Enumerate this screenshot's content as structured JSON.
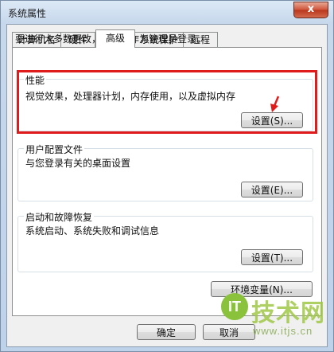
{
  "window": {
    "title": "系统属性",
    "close_glyph": "x"
  },
  "tabs": [
    {
      "label": "计算机名"
    },
    {
      "label": "硬件"
    },
    {
      "label": "高级"
    },
    {
      "label": "系统保护"
    },
    {
      "label": "远程"
    }
  ],
  "active_tab": "高级",
  "admin_note": "要进行大多数更改，您必须作为管理员登录。",
  "performance": {
    "title": "性能",
    "description": "视觉效果，处理器计划，内存使用，以及虚拟内存",
    "button_label": "设置(S)..."
  },
  "user_profiles": {
    "title": "用户配置文件",
    "description": "与您登录有关的桌面设置",
    "button_label": "设置(E)..."
  },
  "startup_recovery": {
    "title": "启动和故障恢复",
    "description": "系统启动、系统失败和调试信息",
    "button_label": "设置(T)..."
  },
  "env_vars_button": "环境变量(N)...",
  "footer": {
    "ok": "确定",
    "cancel": "取消"
  },
  "annotation": {
    "highlight_color": "#e01b1b",
    "arrow_color": "#e01b1b"
  },
  "watermark": {
    "logo_text": "IT",
    "brand": "技术网",
    "url": "www.itjs.cn"
  }
}
